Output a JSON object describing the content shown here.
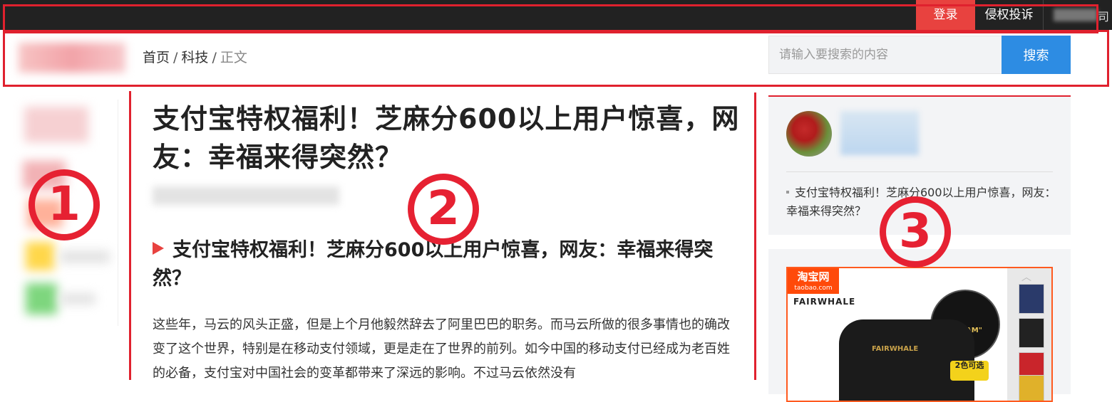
{
  "topbar": {
    "login_label": "登录",
    "complaint_label": "侵权投诉",
    "user_char": "司"
  },
  "header": {
    "breadcrumb": [
      {
        "label": "首页"
      },
      {
        "label": "科技"
      },
      {
        "label": "正文"
      }
    ],
    "search_placeholder": "请输入要搜索的内容",
    "search_button": "搜索"
  },
  "article": {
    "title": "支付宝特权福利！芝麻分600以上用户惊喜，网友：幸福来得突然？",
    "subtitle": "支付宝特权福利！芝麻分600以上用户惊喜，网友：幸福来得突然？",
    "body": "这些年，马云的风头正盛，但是上个月他毅然辞去了阿里巴巴的职务。而马云所做的很多事情也的确改变了这个世界，特别是在移动支付领域，更是走在了世界的前列。如今中国的移动支付已经成为老百姓的必备，支付宝对中国社会的变革都带来了深远的影响。不过马云依然没有"
  },
  "sidebar": {
    "related_link": "支付宝特权福利！芝麻分600以上用户惊喜，网友：幸福来得突然？",
    "ad": {
      "logo": "淘宝网",
      "logo_sub": "taobao.com",
      "brand": "FAIRWHALE",
      "shirt_text": "FAIRWHALE",
      "badge_text": "\"DREAM\"",
      "colors_label": "2色可选"
    }
  },
  "annotations": {
    "left_marker": "①",
    "center_marker": "②",
    "right_marker": "③",
    "left_value": "1",
    "center_value": "2",
    "right_value": "3"
  },
  "colors": {
    "login": "#e8423f",
    "search": "#2d8ce3",
    "annotation": "#e0212e",
    "topbar": "#222222"
  }
}
